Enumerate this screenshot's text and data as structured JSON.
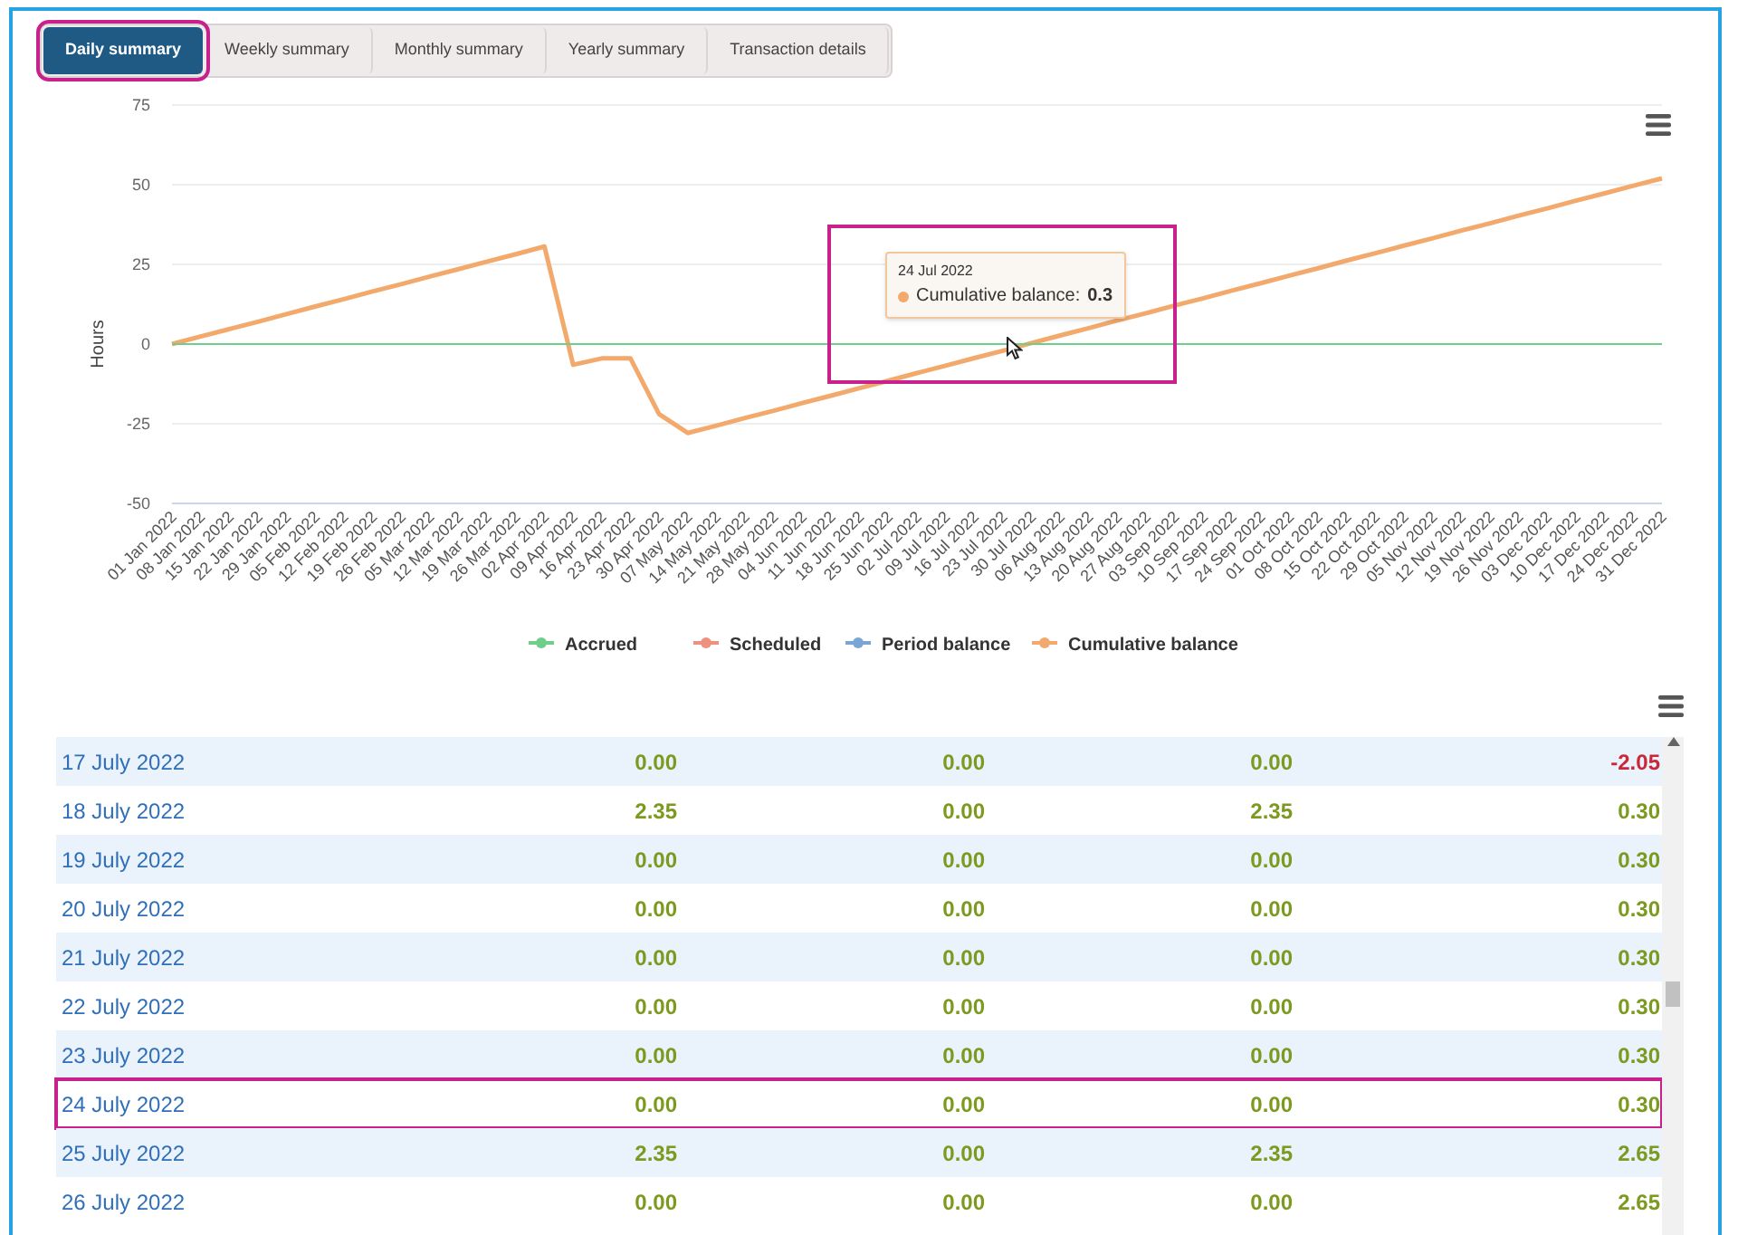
{
  "tabs": [
    {
      "label": "Daily summary",
      "selected": true,
      "highlighted": true
    },
    {
      "label": "Weekly summary",
      "selected": false,
      "highlighted": false
    },
    {
      "label": "Monthly summary",
      "selected": false,
      "highlighted": false
    },
    {
      "label": "Yearly summary",
      "selected": false,
      "highlighted": false
    },
    {
      "label": "Transaction details",
      "selected": false,
      "highlighted": false
    }
  ],
  "chart": {
    "chart_data": {
      "type": "line",
      "grid": true,
      "legend": true,
      "ylabel": "Hours",
      "ylim": [
        -50,
        75
      ],
      "yticks": [
        75,
        50,
        25,
        0,
        -25,
        -50
      ],
      "categories": [
        "01 Jan 2022",
        "08 Jan 2022",
        "15 Jan 2022",
        "22 Jan 2022",
        "29 Jan 2022",
        "05 Feb 2022",
        "12 Feb 2022",
        "19 Feb 2022",
        "26 Feb 2022",
        "05 Mar 2022",
        "12 Mar 2022",
        "19 Mar 2022",
        "26 Mar 2022",
        "02 Apr 2022",
        "09 Apr 2022",
        "16 Apr 2022",
        "23 Apr 2022",
        "30 Apr 2022",
        "07 May 2022",
        "14 May 2022",
        "21 May 2022",
        "28 May 2022",
        "04 Jun 2022",
        "11 Jun 2022",
        "18 Jun 2022",
        "25 Jun 2022",
        "02 Jul 2022",
        "09 Jul 2022",
        "16 Jul 2022",
        "23 Jul 2022",
        "30 Jul 2022",
        "06 Aug 2022",
        "13 Aug 2022",
        "20 Aug 2022",
        "27 Aug 2022",
        "03 Sep 2022",
        "10 Sep 2022",
        "17 Sep 2022",
        "24 Sep 2022",
        "01 Oct 2022",
        "08 Oct 2022",
        "15 Oct 2022",
        "22 Oct 2022",
        "29 Oct 2022",
        "05 Nov 2022",
        "12 Nov 2022",
        "19 Nov 2022",
        "26 Nov 2022",
        "03 Dec 2022",
        "10 Dec 2022",
        "17 Dec 2022",
        "24 Dec 2022",
        "31 Dec 2022"
      ],
      "series": [
        {
          "name": "Accrued",
          "color": "#6fcf8a",
          "values": [
            0,
            0,
            0,
            0,
            0,
            0,
            0,
            0,
            0,
            0,
            0,
            0,
            0,
            0,
            0,
            0,
            0,
            0,
            0,
            0,
            0,
            0,
            0,
            0,
            0,
            0,
            0,
            0,
            0,
            0,
            0,
            0,
            0,
            0,
            0,
            0,
            0,
            0,
            0,
            0,
            0,
            0,
            0,
            0,
            0,
            0,
            0,
            0,
            0,
            0,
            0,
            0,
            0
          ]
        },
        {
          "name": "Scheduled",
          "color": "#f0907f",
          "values": [
            null,
            null,
            null,
            null,
            null,
            null,
            null,
            null,
            null,
            null,
            null,
            null,
            null,
            null,
            null,
            null,
            null,
            null,
            null,
            null,
            null,
            null,
            null,
            null,
            null,
            null,
            null,
            null,
            null,
            null,
            null,
            null,
            null,
            null,
            null,
            null,
            null,
            null,
            null,
            null,
            null,
            null,
            null,
            null,
            null,
            null,
            null,
            null,
            null,
            null,
            null,
            null,
            null
          ]
        },
        {
          "name": "Period balance",
          "color": "#7aa6d6",
          "values": [
            null,
            null,
            null,
            null,
            null,
            null,
            null,
            null,
            null,
            null,
            null,
            null,
            null,
            null,
            null,
            null,
            null,
            null,
            null,
            null,
            null,
            null,
            null,
            null,
            null,
            null,
            null,
            null,
            null,
            null,
            null,
            null,
            null,
            null,
            null,
            null,
            null,
            null,
            null,
            null,
            null,
            null,
            null,
            null,
            null,
            null,
            null,
            null,
            null,
            null,
            null,
            null,
            null
          ]
        },
        {
          "name": "Cumulative balance",
          "color": "#f2a96b",
          "values": [
            0,
            2.4,
            4.7,
            7,
            9.4,
            11.8,
            14.1,
            16.5,
            18.8,
            21.2,
            23.5,
            25.9,
            28.2,
            30.6,
            -6.5,
            -4.5,
            -4.5,
            -22,
            -27.9,
            -25.6,
            -23.2,
            -20.9,
            -18.5,
            -16.2,
            -13.8,
            -11.5,
            -9.1,
            -6.8,
            -4.4,
            -2.1,
            0.3,
            2.7,
            5,
            7.4,
            9.7,
            12.1,
            14.4,
            16.8,
            19.1,
            21.5,
            23.8,
            26.2,
            28.5,
            30.9,
            33.2,
            35.6,
            37.9,
            40.3,
            42.6,
            45,
            47.3,
            49.7,
            52
          ]
        }
      ]
    },
    "tooltip": {
      "date": "24 Jul 2022",
      "label": "Cumulative balance:",
      "value": "0.3",
      "highlighted": true
    }
  },
  "table": {
    "rows": [
      {
        "date": "17 July 2022",
        "highlighted": false,
        "cells": [
          {
            "text": "0.00",
            "negative": false
          },
          {
            "text": "0.00",
            "negative": false
          },
          {
            "text": "0.00",
            "negative": false
          },
          {
            "text": "-2.05",
            "negative": true
          }
        ]
      },
      {
        "date": "18 July 2022",
        "highlighted": false,
        "cells": [
          {
            "text": "2.35",
            "negative": false
          },
          {
            "text": "0.00",
            "negative": false
          },
          {
            "text": "2.35",
            "negative": false
          },
          {
            "text": "0.30",
            "negative": false
          }
        ]
      },
      {
        "date": "19 July 2022",
        "highlighted": false,
        "cells": [
          {
            "text": "0.00",
            "negative": false
          },
          {
            "text": "0.00",
            "negative": false
          },
          {
            "text": "0.00",
            "negative": false
          },
          {
            "text": "0.30",
            "negative": false
          }
        ]
      },
      {
        "date": "20 July 2022",
        "highlighted": false,
        "cells": [
          {
            "text": "0.00",
            "negative": false
          },
          {
            "text": "0.00",
            "negative": false
          },
          {
            "text": "0.00",
            "negative": false
          },
          {
            "text": "0.30",
            "negative": false
          }
        ]
      },
      {
        "date": "21 July 2022",
        "highlighted": false,
        "cells": [
          {
            "text": "0.00",
            "negative": false
          },
          {
            "text": "0.00",
            "negative": false
          },
          {
            "text": "0.00",
            "negative": false
          },
          {
            "text": "0.30",
            "negative": false
          }
        ]
      },
      {
        "date": "22 July 2022",
        "highlighted": false,
        "cells": [
          {
            "text": "0.00",
            "negative": false
          },
          {
            "text": "0.00",
            "negative": false
          },
          {
            "text": "0.00",
            "negative": false
          },
          {
            "text": "0.30",
            "negative": false
          }
        ]
      },
      {
        "date": "23 July 2022",
        "highlighted": false,
        "cells": [
          {
            "text": "0.00",
            "negative": false
          },
          {
            "text": "0.00",
            "negative": false
          },
          {
            "text": "0.00",
            "negative": false
          },
          {
            "text": "0.30",
            "negative": false
          }
        ]
      },
      {
        "date": "24 July 2022",
        "highlighted": true,
        "cells": [
          {
            "text": "0.00",
            "negative": false
          },
          {
            "text": "0.00",
            "negative": false
          },
          {
            "text": "0.00",
            "negative": false
          },
          {
            "text": "0.30",
            "negative": false
          }
        ]
      },
      {
        "date": "25 July 2022",
        "highlighted": false,
        "cells": [
          {
            "text": "2.35",
            "negative": false
          },
          {
            "text": "0.00",
            "negative": false
          },
          {
            "text": "2.35",
            "negative": false
          },
          {
            "text": "2.65",
            "negative": false
          }
        ]
      },
      {
        "date": "26 July 2022",
        "highlighted": false,
        "cells": [
          {
            "text": "0.00",
            "negative": false
          },
          {
            "text": "0.00",
            "negative": false
          },
          {
            "text": "0.00",
            "negative": false
          },
          {
            "text": "2.65",
            "negative": false
          }
        ]
      }
    ]
  }
}
